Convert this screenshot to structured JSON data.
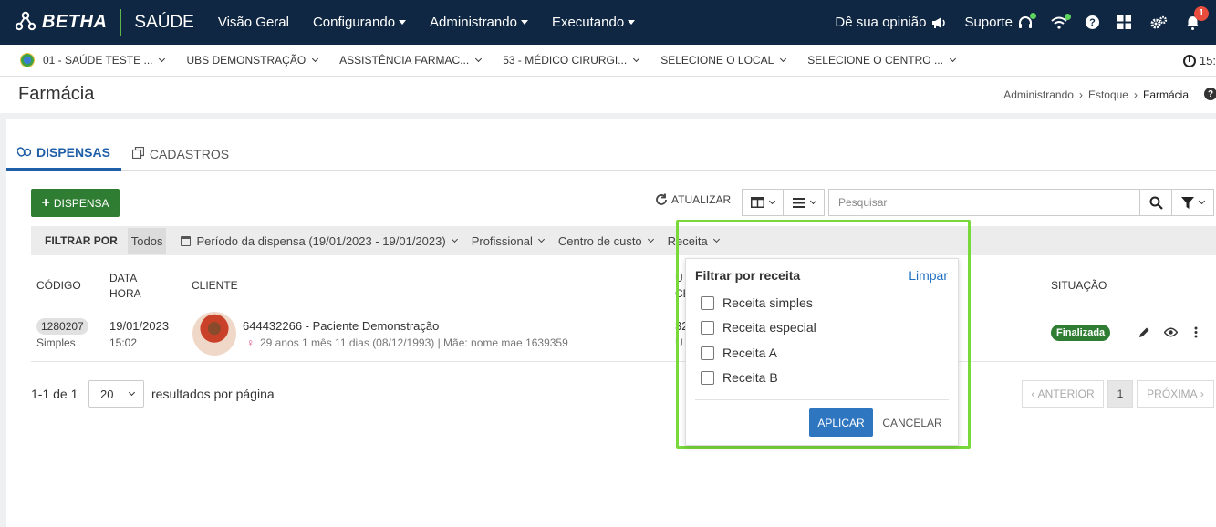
{
  "navbar": {
    "brand": "BETHA",
    "product": "SAÚDE",
    "menu": [
      {
        "label": "Visão Geral"
      },
      {
        "label": "Configurando"
      },
      {
        "label": "Administrando"
      },
      {
        "label": "Executando"
      }
    ],
    "feedback_label": "Dê sua opinião",
    "support_label": "Suporte",
    "notifications_count": "1",
    "accent_color": "#5fb548",
    "bg_color": "#0f2742"
  },
  "context": {
    "entity": "01 - SAÚDE TESTE ...",
    "unit": "UBS DEMONSTRAÇÃO",
    "sector": "ASSISTÊNCIA FARMAC...",
    "professional": "53 - MÉDICO CIRURGI...",
    "location": "SELECIONE O LOCAL",
    "center": "SELECIONE O CENTRO ...",
    "time": "15:"
  },
  "page": {
    "title": "Farmácia",
    "breadcrumb": [
      "Administrando",
      "Estoque",
      "Farmácia"
    ]
  },
  "tabs": [
    {
      "label": "DISPENSAS",
      "active": true
    },
    {
      "label": "CADASTROS",
      "active": false
    }
  ],
  "toolbar": {
    "add_label": "DISPENSA",
    "refresh_label": "ATUALIZAR",
    "search_placeholder": "Pesquisar"
  },
  "filters": {
    "label": "FILTRAR POR",
    "all_label": "Todos",
    "items": [
      {
        "label": "Período da dispensa (19/01/2023 - 19/01/2023)"
      },
      {
        "label": "Profissional"
      },
      {
        "label": "Centro de custo"
      },
      {
        "label": "Receita"
      }
    ]
  },
  "table": {
    "headers": {
      "code": "CÓDIGO",
      "date_line1": "DATA",
      "date_line2": "HORA",
      "client": "CLIENTE",
      "unit_partial_line1": "U",
      "unit_partial_line2": "CE",
      "status": "SITUAÇÃO"
    },
    "rows": [
      {
        "code": "1280207",
        "type": "Simples",
        "date": "19/01/2023",
        "time": "15:02",
        "client_name": "644432266 - Paciente Demonstração",
        "client_info": "29 anos 1 mês 11 dias (08/12/1993) | Mãe: nome mae 1639359",
        "unit_partial_line1": "32",
        "unit_partial_line2": "U",
        "status": "Finalizada",
        "status_color": "#2e7d32"
      }
    ]
  },
  "pagination": {
    "summary": "1-1 de 1",
    "per_page": "20",
    "per_page_label": "resultados por página",
    "prev_label": "ANTERIOR",
    "current_page": "1",
    "next_label": "PRÓXIMA"
  },
  "dropdown": {
    "title": "Filtrar por receita",
    "clear_label": "Limpar",
    "options": [
      {
        "label": "Receita simples",
        "checked": false
      },
      {
        "label": "Receita especial",
        "checked": false
      },
      {
        "label": "Receita A",
        "checked": false
      },
      {
        "label": "Receita B",
        "checked": false
      }
    ],
    "apply_label": "APLICAR",
    "cancel_label": "CANCELAR",
    "highlight_color": "#7ad93a"
  }
}
